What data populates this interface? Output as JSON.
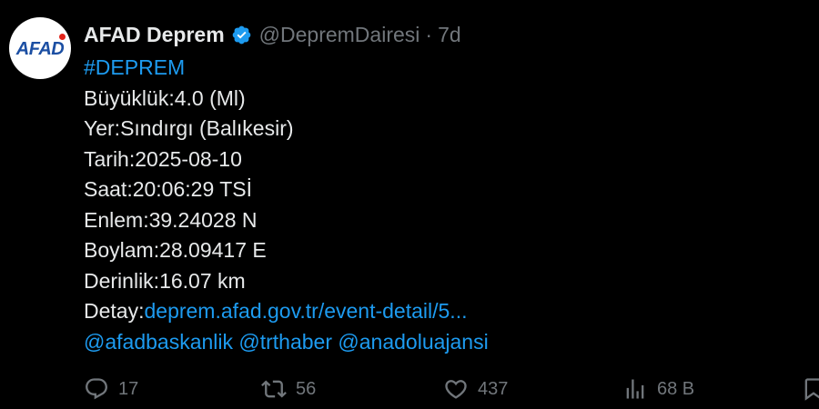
{
  "account": {
    "avatar_text": "AFAD",
    "display_name": "AFAD Deprem",
    "handle": "@DepremDairesi",
    "separator": "·",
    "time": "7d",
    "verified_color": "#1d9bf0"
  },
  "tweet": {
    "hashtag": "#DEPREM",
    "magnitude": "Büyüklük:4.0 (Ml)",
    "location": "Yer:Sındırgı (Balıkesir)",
    "date": "Tarih:2025-08-10",
    "time": "Saat:20:06:29 TSİ",
    "latitude": "Enlem:39.24028 N",
    "longitude": "Boylam:28.09417 E",
    "depth": "Derinlik:16.07 km",
    "detail_label": "Detay:",
    "detail_link": "deprem.afad.gov.tr/event-detail/5...",
    "mention_1": "@afadbaskanlik",
    "mention_2": "@trthaber",
    "mention_3": "@anadoluajansi"
  },
  "actions": {
    "replies": "17",
    "reposts": "56",
    "likes": "437",
    "views": "68 B"
  },
  "colors": {
    "background": "#000000",
    "text": "#e7e9ea",
    "secondary": "#71767b",
    "link": "#1d9bf0",
    "brand_blue": "#1c4fa3",
    "brand_red": "#e2231a"
  },
  "icons": [
    "verified-badge-icon",
    "reply-icon",
    "repost-icon",
    "like-icon",
    "views-icon",
    "bookmark-icon"
  ]
}
